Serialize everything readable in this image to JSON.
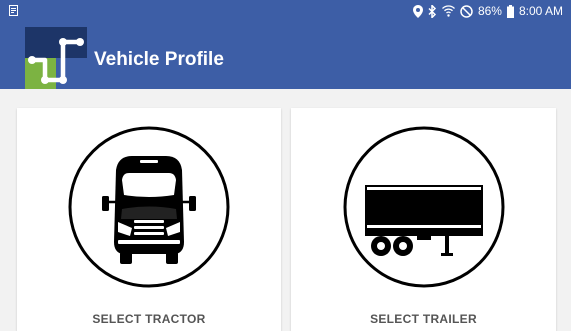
{
  "status_bar": {
    "battery": "86%",
    "time": "8:00 AM",
    "icons": [
      "notification-icon",
      "location-icon",
      "bluetooth-icon",
      "wifi-icon",
      "do-not-disturb-icon",
      "battery-icon"
    ]
  },
  "header": {
    "title": "Vehicle Profile",
    "logo": "app-logo",
    "background_color": "#3d5ea6"
  },
  "cards": {
    "tractor": {
      "label": "SELECT TRACTOR",
      "icon": "tractor-icon"
    },
    "trailer": {
      "label": "SELECT TRAILER",
      "icon": "trailer-icon"
    }
  }
}
